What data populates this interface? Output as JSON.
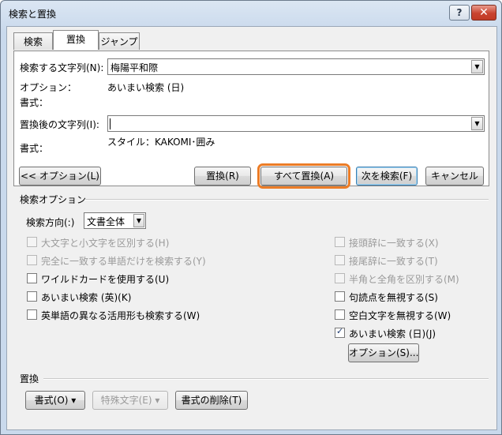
{
  "window": {
    "title": "検索と置換",
    "help_label": "?",
    "close_label": "✕"
  },
  "tabs": [
    {
      "label": "検索"
    },
    {
      "label": "置換"
    },
    {
      "label": "ジャンプ"
    }
  ],
  "find": {
    "label": "検索する文字列(N):",
    "value": "梅陽平和際",
    "options_label": "オプション：",
    "options_value": "あいまい検索 (日)",
    "format_label": "書式："
  },
  "replace": {
    "label": "置換後の文字列(I):",
    "value": "",
    "format_label": "書式：",
    "format_value": "スタイル：KAKOMI･囲み"
  },
  "buttons": {
    "options": "<< オプション(L)",
    "replace": "置換(R)",
    "replace_all": "すべて置換(A)",
    "find_next": "次を検索(F)",
    "cancel": "キャンセル"
  },
  "search_options": {
    "title": "検索オプション",
    "direction_label": "検索方向(:)",
    "direction_value": "文書全体",
    "left_options": [
      {
        "label": "大文字と小文字を区別する(H)",
        "checked": false,
        "enabled": false
      },
      {
        "label": "完全に一致する単語だけを検索する(Y)",
        "checked": false,
        "enabled": false
      },
      {
        "label": "ワイルドカードを使用する(U)",
        "checked": false,
        "enabled": true
      },
      {
        "label": "あいまい検索 (英)(K)",
        "checked": false,
        "enabled": true
      },
      {
        "label": "英単語の異なる活用形も検索する(W)",
        "checked": false,
        "enabled": true
      }
    ],
    "right_options": [
      {
        "label": "接頭辞に一致する(X)",
        "checked": false,
        "enabled": false
      },
      {
        "label": "接尾辞に一致する(T)",
        "checked": false,
        "enabled": false
      },
      {
        "label": "半角と全角を区別する(M)",
        "checked": false,
        "enabled": false
      },
      {
        "label": "句読点を無視する(S)",
        "checked": false,
        "enabled": true
      },
      {
        "label": "空白文字を無視する(W)",
        "checked": false,
        "enabled": true
      },
      {
        "label": "あいまい検索 (日)(J)",
        "checked": true,
        "enabled": true
      }
    ],
    "fuzzy_options_button": "オプション(S)..."
  },
  "replace_section": {
    "title": "置換",
    "format_button": "書式(O) ▾",
    "special_button": "特殊文字(E) ▾",
    "clear_format_button": "書式の削除(T)"
  }
}
